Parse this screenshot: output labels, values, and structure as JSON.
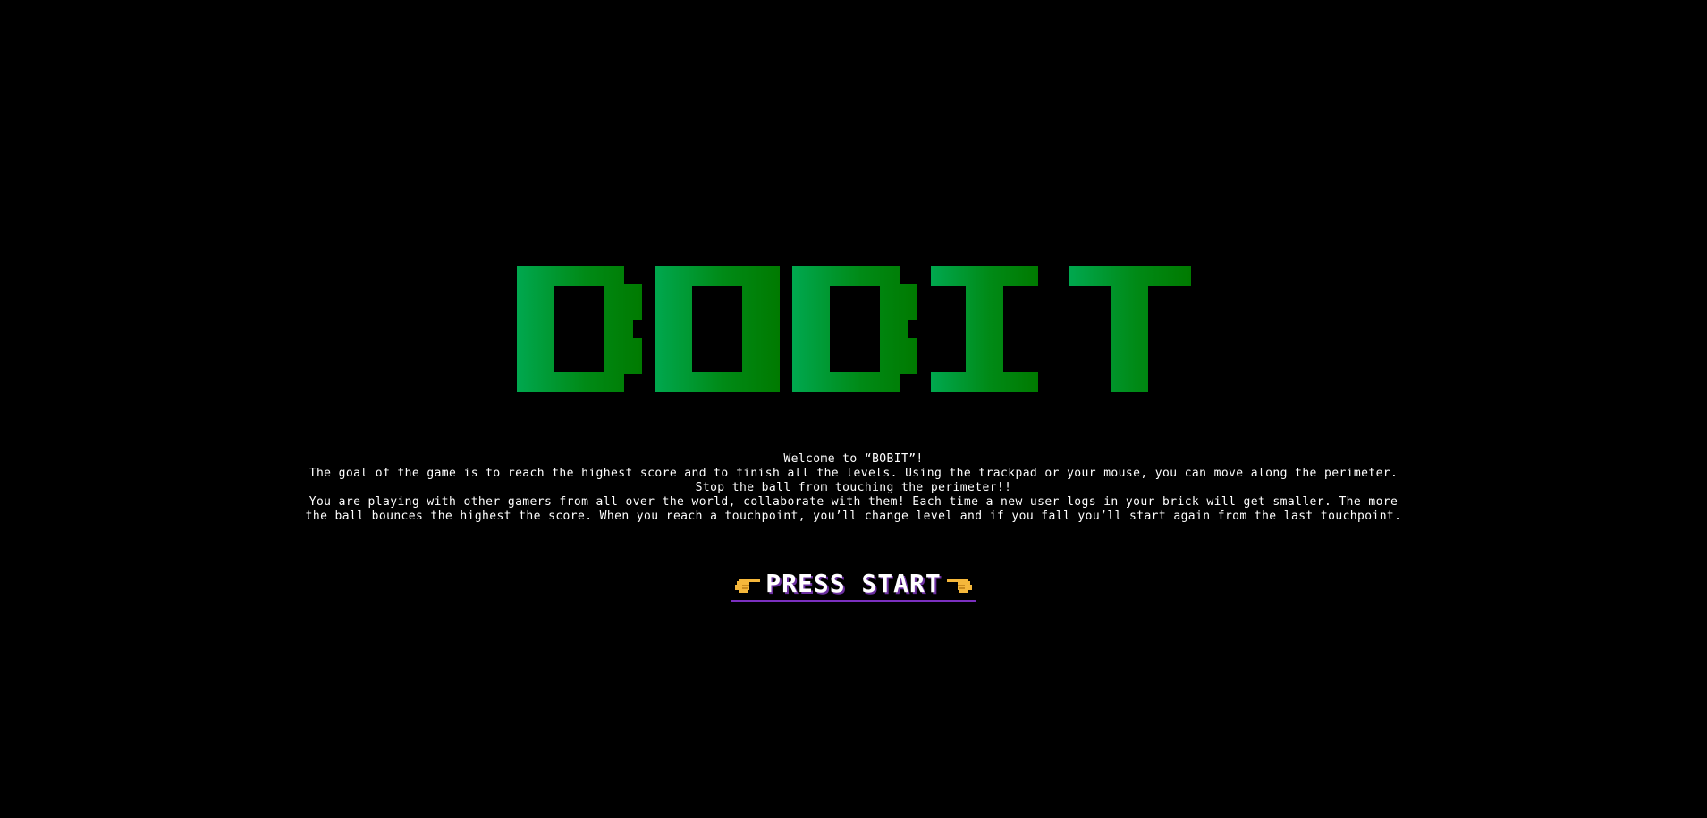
{
  "game": {
    "title": "BOBIT",
    "title_colors": {
      "start": "#00a84f",
      "end": "#007a00"
    }
  },
  "intro": {
    "lines": [
      "Welcome to “BOBIT”!",
      "The goal of the game is to reach the highest score and to finish all the levels. Using the trackpad or your mouse, you can move along the perimeter.",
      "Stop the ball from touching the perimeter!!",
      "You are playing with other gamers from all over the world, collaborate with them! Each time a new user logs in your brick will get smaller. The more",
      "the ball bounces the highest the score. When you reach a touchpoint, you’ll change level and if you fall you’ll start again from the last touchpoint."
    ]
  },
  "start": {
    "label": "PRESS START",
    "left_icon": "pointing-right-hand-icon",
    "right_icon": "pointing-left-hand-icon",
    "underline_color": "#7b2fbf"
  },
  "colors": {
    "background": "#000000",
    "text": "#ffffff",
    "hand": "#f5b73b"
  }
}
